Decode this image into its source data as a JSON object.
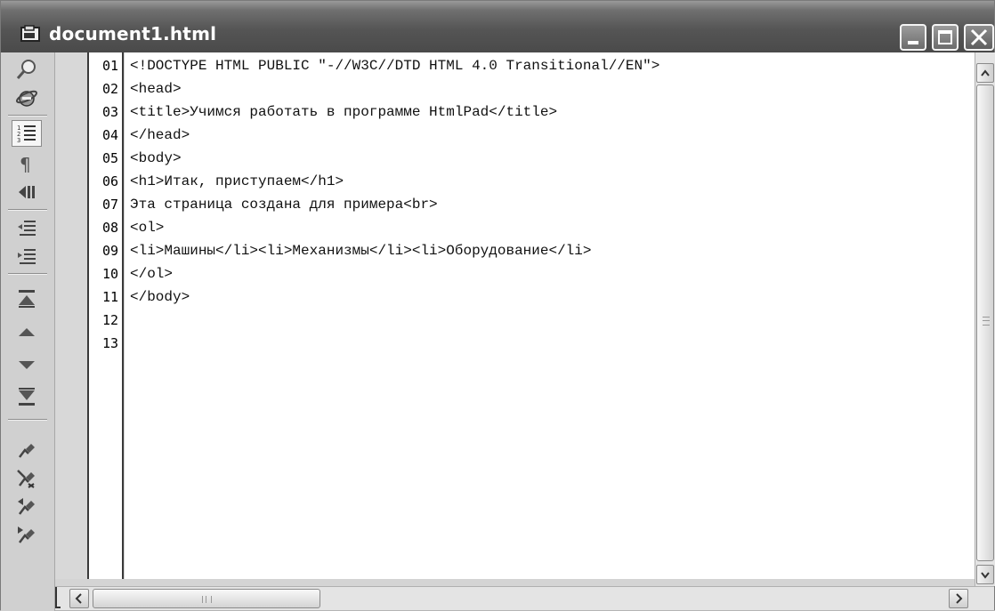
{
  "window": {
    "title": "document1.html"
  },
  "toolbar": {
    "items": [
      {
        "name": "find-icon"
      },
      {
        "name": "browser-preview-icon"
      },
      {
        "name": "line-numbers-icon",
        "active": true
      },
      {
        "name": "pilcrow-icon"
      },
      {
        "name": "word-wrap-icon"
      },
      {
        "name": "indent-icon"
      },
      {
        "name": "outdent-icon"
      },
      {
        "name": "go-to-top-icon"
      },
      {
        "name": "page-up-icon"
      },
      {
        "name": "page-down-icon"
      },
      {
        "name": "go-to-bottom-icon"
      },
      {
        "name": "toggle-bookmark-icon"
      },
      {
        "name": "clear-bookmarks-icon"
      },
      {
        "name": "previous-bookmark-icon"
      },
      {
        "name": "next-bookmark-icon"
      }
    ]
  },
  "editor": {
    "line_numbers": [
      "01",
      "02",
      "03",
      "04",
      "05",
      "06",
      "07",
      "08",
      "09",
      "10",
      "11",
      "12",
      "13"
    ],
    "lines": [
      "<!DOCTYPE HTML PUBLIC \"-//W3C//DTD HTML 4.0 Transitional//EN\">",
      "<head>",
      "<title>Учимся работать в программе HtmlPad</title>",
      "</head>",
      "<body>",
      "<h1>Итак, приступаем</h1>",
      "Эта страница создана для примера<br>",
      "<ol>",
      "<li>Машины</li><li>Механизмы</li><li>Оборудование</li>",
      "</ol>",
      "</body>",
      "",
      ""
    ]
  }
}
